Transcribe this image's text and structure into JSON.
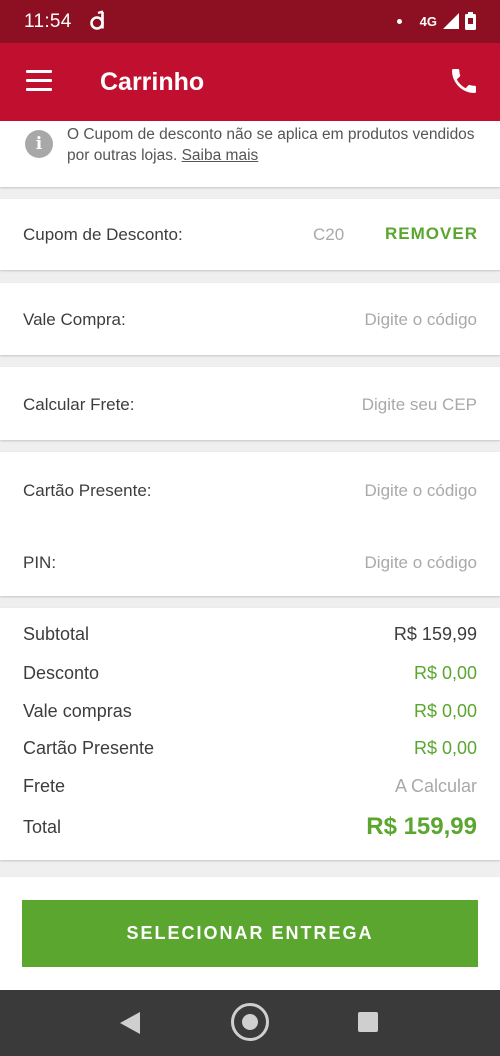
{
  "status_bar": {
    "time": "11:54",
    "network": "4G",
    "app_icon": "d-logo-icon",
    "signal_icon": "signal-icon",
    "battery_icon": "battery-icon"
  },
  "app_bar": {
    "title": "Carrinho",
    "menu_icon": "menu-icon",
    "phone_icon": "phone-icon"
  },
  "notice": {
    "icon": "info-icon",
    "text": "O Cupom de desconto não se aplica em produtos vendidos por outras lojas.",
    "link": "Saiba mais"
  },
  "coupon": {
    "label": "Cupom de Desconto:",
    "code": "C20",
    "remove_label": "REMOVER"
  },
  "vale_compra": {
    "label": "Vale Compra:",
    "placeholder": "Digite o código"
  },
  "frete": {
    "label": "Calcular Frete:",
    "placeholder": "Digite seu CEP"
  },
  "cartao_presente": {
    "label": "Cartão Presente:",
    "placeholder": "Digite o código"
  },
  "pin": {
    "label": "PIN:",
    "placeholder": "Digite o código"
  },
  "totals": {
    "subtotal_label": "Subtotal",
    "subtotal_value": "R$ 159,99",
    "desconto_label": "Desconto",
    "desconto_value": "R$ 0,00",
    "vale_label": "Vale compras",
    "vale_value": "R$ 0,00",
    "cartao_label": "Cartão Presente",
    "cartao_value": "R$ 0,00",
    "frete_label": "Frete",
    "frete_value": "A Calcular",
    "total_label": "Total",
    "total_value": "R$ 159,99"
  },
  "cta": {
    "label": "SELECIONAR ENTREGA"
  },
  "colors": {
    "status_bar": "#8d0f22",
    "app_bar": "#c1102f",
    "accent_green": "#5aa62f",
    "nav_bar": "#3a3a3a"
  }
}
